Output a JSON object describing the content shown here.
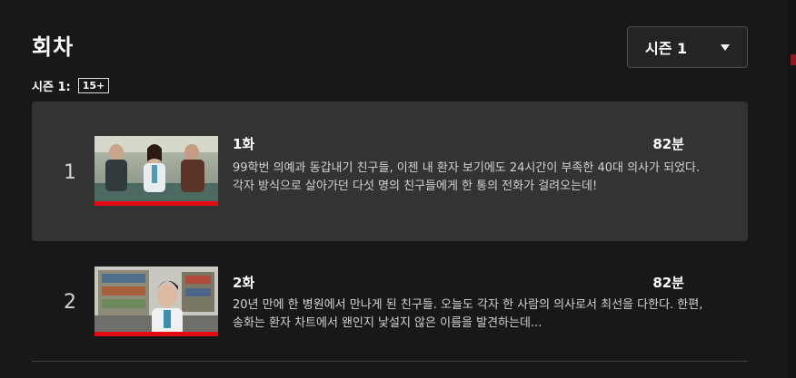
{
  "header": {
    "title": "회차"
  },
  "season_select": {
    "selected": "시즌 1"
  },
  "season_info": {
    "label": "시즌 1:",
    "rating": "15+"
  },
  "episodes": [
    {
      "number": "1",
      "title": "1화",
      "duration": "82분",
      "description": "99학번 의예과 동갑내기 친구들, 이젠 내 환자 보기에도 24시간이 부족한 40대 의사가 되었다. 각자 방식으로 살아가던 다섯 명의 친구들에게 한 통의 전화가 걸려오는데!",
      "progress_percent": 100
    },
    {
      "number": "2",
      "title": "2화",
      "duration": "82분",
      "description": "20년 만에 한 병원에서 만나게 된 친구들. 오늘도 각자 한 사람의 의사로서 최선을 다한다. 한편, 송화는 환자 차트에서 왠인지 낯설지 않은 이름을 발견하는데...",
      "progress_percent": 100
    }
  ],
  "colors": {
    "accent": "#e50914",
    "background": "#181818",
    "active_row": "#333333"
  }
}
